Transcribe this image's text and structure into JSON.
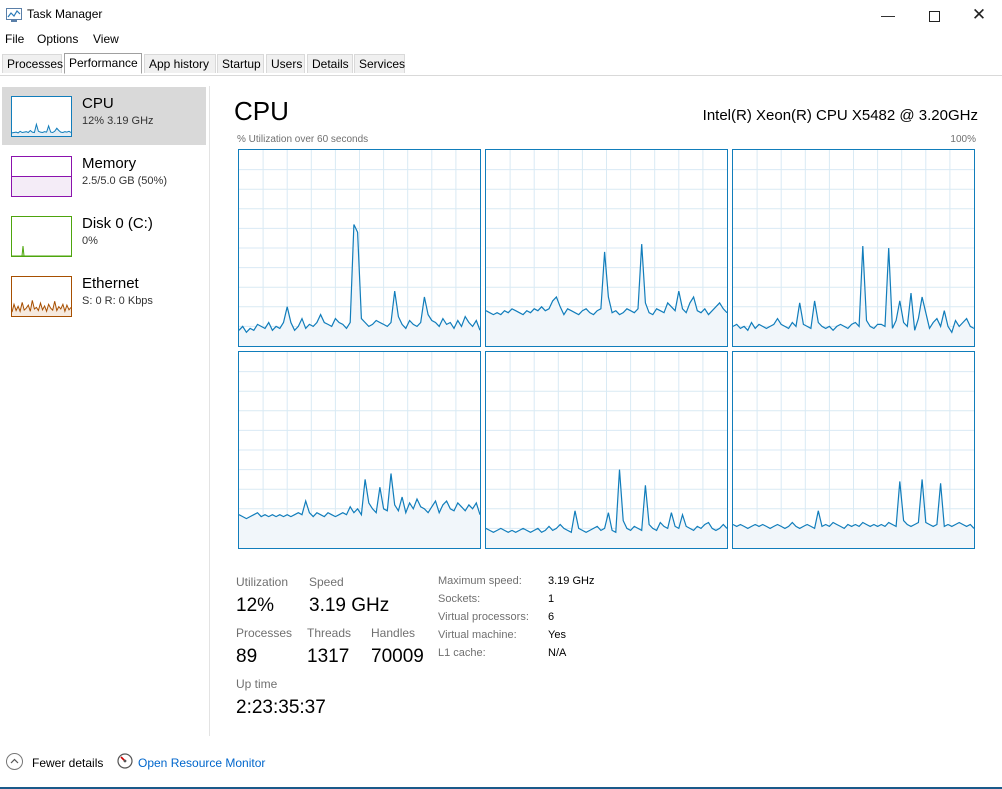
{
  "window": {
    "title": "Task Manager"
  },
  "menu": [
    "File",
    "Options",
    "View"
  ],
  "tabs": [
    "Processes",
    "Performance",
    "App history",
    "Startup",
    "Users",
    "Details",
    "Services"
  ],
  "active_tab": "Performance",
  "sidebar": [
    {
      "name": "CPU",
      "sub": "12%  3.19 GHz",
      "color": "#117dbb"
    },
    {
      "name": "Memory",
      "sub": "2.5/5.0 GB (50%)",
      "color": "#8b12ae"
    },
    {
      "name": "Disk 0 (C:)",
      "sub": "0%",
      "color": "#4da60c"
    },
    {
      "name": "Ethernet",
      "sub": "S: 0  R: 0 Kbps",
      "color": "#a74f01"
    }
  ],
  "main": {
    "title": "CPU",
    "model": "Intel(R) Xeon(R) CPU X5482 @ 3.20GHz",
    "graph_label": "% Utilization over 60 seconds",
    "graph_max": "100%",
    "graph_color": "#117dbb",
    "graph_fill": "#f1f6fa"
  },
  "cpu_graphs": [
    [
      8,
      10,
      7,
      9,
      8,
      11,
      10,
      9,
      12,
      8,
      10,
      9,
      12,
      20,
      12,
      8,
      10,
      14,
      9,
      11,
      10,
      12,
      16,
      12,
      11,
      10,
      14,
      12,
      11,
      9,
      12,
      62,
      58,
      14,
      12,
      10,
      11,
      13,
      12,
      11,
      10,
      12,
      28,
      15,
      11,
      9,
      13,
      11,
      10,
      12,
      25,
      16,
      13,
      12,
      10,
      14,
      11,
      12,
      9,
      13,
      10,
      15,
      12,
      10,
      13,
      8
    ],
    [
      18,
      17,
      16,
      17,
      16,
      18,
      17,
      19,
      18,
      17,
      16,
      18,
      17,
      19,
      18,
      20,
      18,
      19,
      23,
      25,
      20,
      16,
      19,
      18,
      17,
      16,
      18,
      19,
      17,
      16,
      18,
      19,
      48,
      25,
      17,
      18,
      16,
      17,
      19,
      18,
      17,
      19,
      52,
      22,
      17,
      16,
      19,
      18,
      17,
      22,
      20,
      18,
      28,
      19,
      17,
      22,
      25,
      18,
      17,
      19,
      16,
      18,
      20,
      22,
      19,
      17
    ],
    [
      10,
      11,
      9,
      10,
      8,
      12,
      9,
      11,
      10,
      9,
      10,
      11,
      14,
      11,
      10,
      9,
      12,
      10,
      22,
      11,
      10,
      9,
      23,
      12,
      10,
      9,
      10,
      8,
      10,
      11,
      10,
      9,
      11,
      12,
      10,
      51,
      13,
      10,
      9,
      11,
      11,
      10,
      50,
      9,
      13,
      23,
      12,
      10,
      27,
      8,
      14,
      25,
      17,
      9,
      12,
      14,
      10,
      18,
      10,
      7,
      13,
      10,
      12,
      14,
      10,
      9
    ],
    [
      17,
      16,
      15,
      16,
      17,
      18,
      16,
      17,
      16,
      17,
      16,
      17,
      16,
      17,
      16,
      17,
      18,
      17,
      24,
      18,
      16,
      18,
      17,
      16,
      18,
      17,
      16,
      17,
      18,
      17,
      21,
      18,
      20,
      17,
      35,
      23,
      20,
      18,
      31,
      20,
      19,
      38,
      22,
      19,
      26,
      18,
      23,
      20,
      25,
      21,
      20,
      18,
      21,
      24,
      18,
      22,
      24,
      20,
      19,
      23,
      21,
      19,
      22,
      20,
      23,
      17
    ],
    [
      10,
      9,
      8,
      9,
      10,
      9,
      8,
      9,
      8,
      9,
      10,
      9,
      8,
      9,
      10,
      8,
      9,
      11,
      9,
      10,
      12,
      10,
      9,
      8,
      19,
      10,
      9,
      8,
      9,
      10,
      11,
      9,
      10,
      18,
      9,
      8,
      40,
      14,
      10,
      9,
      11,
      10,
      9,
      32,
      12,
      10,
      9,
      13,
      11,
      10,
      18,
      11,
      10,
      17,
      11,
      10,
      9,
      11,
      10,
      12,
      13,
      10,
      9,
      10,
      12,
      10
    ],
    [
      12,
      11,
      12,
      11,
      10,
      11,
      12,
      11,
      12,
      11,
      10,
      11,
      12,
      11,
      10,
      11,
      13,
      11,
      10,
      11,
      12,
      11,
      10,
      19,
      11,
      12,
      11,
      13,
      12,
      11,
      10,
      12,
      11,
      12,
      11,
      13,
      12,
      11,
      12,
      11,
      12,
      11,
      13,
      12,
      11,
      34,
      14,
      12,
      11,
      12,
      13,
      35,
      13,
      12,
      11,
      12,
      33,
      11,
      12,
      11,
      12,
      13,
      12,
      11,
      12,
      10
    ]
  ],
  "stats": {
    "utilization": {
      "label": "Utilization",
      "value": "12%"
    },
    "speed": {
      "label": "Speed",
      "value": "3.19 GHz"
    },
    "processes": {
      "label": "Processes",
      "value": "89"
    },
    "threads": {
      "label": "Threads",
      "value": "1317"
    },
    "handles": {
      "label": "Handles",
      "value": "70009"
    },
    "uptime": {
      "label": "Up time",
      "value": "2:23:35:37"
    }
  },
  "details": [
    {
      "label": "Maximum speed:",
      "value": "3.19 GHz"
    },
    {
      "label": "Sockets:",
      "value": "1"
    },
    {
      "label": "Virtual processors:",
      "value": "6"
    },
    {
      "label": "Virtual machine:",
      "value": "Yes"
    },
    {
      "label": "L1 cache:",
      "value": "N/A"
    }
  ],
  "footer": {
    "fewer_details": "Fewer details",
    "open_resource_monitor": "Open Resource Monitor"
  },
  "icons": {
    "app": "task-manager-icon",
    "minimize": "minimize-icon",
    "maximize": "maximize-icon",
    "close": "close-icon",
    "fewer": "chevron-up-icon",
    "resource_monitor": "resource-monitor-icon"
  }
}
